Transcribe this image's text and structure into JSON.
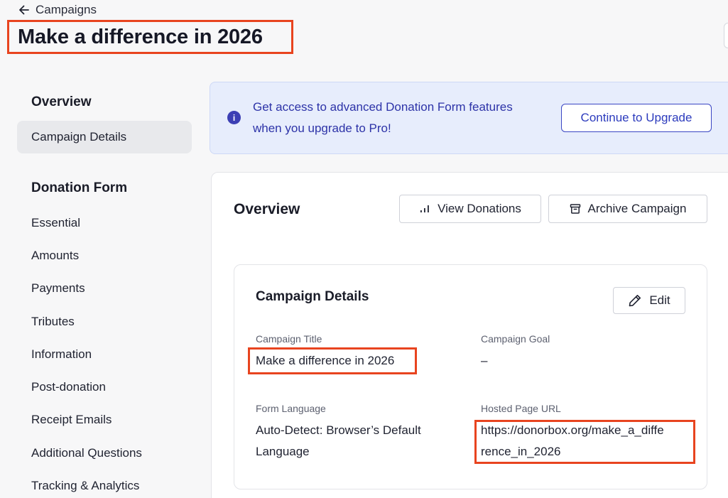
{
  "header": {
    "back_label": "Campaigns",
    "title": "Make a difference in 2026"
  },
  "sidebar": {
    "sections": [
      {
        "heading": "Overview",
        "items": [
          "Campaign Details"
        ]
      },
      {
        "heading": "Donation Form",
        "items": [
          "Essential",
          "Amounts",
          "Payments",
          "Tributes",
          "Information",
          "Post-donation",
          "Receipt Emails",
          "Additional Questions",
          "Tracking & Analytics"
        ]
      }
    ],
    "active_item": "Campaign Details"
  },
  "banner": {
    "text_line1": "Get access to advanced Donation Form features",
    "text_line2": "when you upgrade to Pro!",
    "button_label": "Continue to Upgrade"
  },
  "overview": {
    "title": "Overview",
    "view_donations_label": "View Donations",
    "archive_label": "Archive Campaign"
  },
  "details": {
    "title": "Campaign Details",
    "edit_label": "Edit",
    "fields": {
      "campaign_title": {
        "label": "Campaign Title",
        "value": "Make a difference in 2026"
      },
      "campaign_goal": {
        "label": "Campaign Goal",
        "value": "–"
      },
      "form_language": {
        "label": "Form Language",
        "value_line1": "Auto-Detect: Browser’s Default",
        "value_line2": "Language"
      },
      "hosted_url": {
        "label": "Hosted Page URL",
        "value_line1": "https://donorbox.org/make_a_diffe",
        "value_line2": "rence_in_2026"
      }
    }
  },
  "colors": {
    "highlight": "#e8441f",
    "brand_blue": "#2c3bbd",
    "banner_bg": "#e7edfc"
  }
}
